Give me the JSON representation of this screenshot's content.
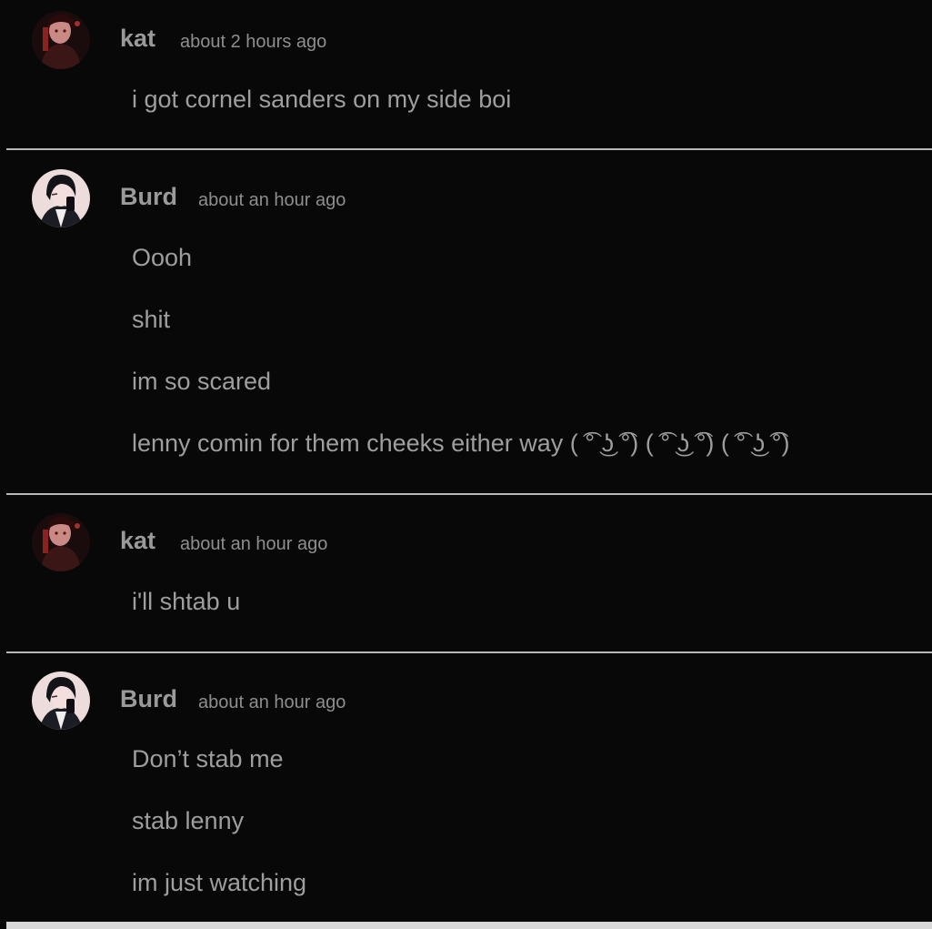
{
  "comments": [
    {
      "author": "kat",
      "time": "about 2 hours ago",
      "avatar": "avatar-kat",
      "lines": [
        "i got cornel sanders on my side boi"
      ]
    },
    {
      "author": "Burd",
      "time": "about an hour ago",
      "avatar": "avatar-burd",
      "lines": [
        "Oooh",
        "shit",
        "im so scared",
        "lenny comin for them cheeks either way ( ͡° ͜ʖ ͡°) ( ͡° ͜ʖ ͡°) ( ͡° ͜ʖ ͡°)"
      ]
    },
    {
      "author": "kat",
      "time": "about an hour ago",
      "avatar": "avatar-kat",
      "lines": [
        "i'll shtab u"
      ]
    },
    {
      "author": "Burd",
      "time": "about an hour ago",
      "avatar": "avatar-burd",
      "lines": [
        "Don’t stab me",
        "stab lenny",
        "im just watching"
      ]
    }
  ],
  "colors": {
    "background": "#080808",
    "author": "#9a9a9a",
    "text": "#9e9e9e",
    "divider": "#b8b8b8"
  }
}
